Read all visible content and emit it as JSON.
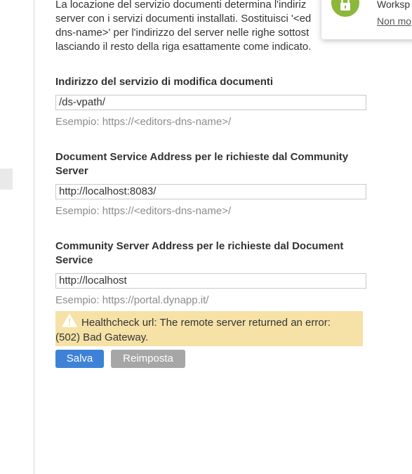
{
  "intro": {
    "text": "La locazione del servizio documenti determina l'indiriz\nserver con i servizi documenti installati. Sostituisci '<ed\ndns-name>' per l'indirizzo del server nelle righe sottost\nlasciando il resto della riga esattamente come indicato."
  },
  "fields": [
    {
      "label": "Indirizzo del servizio di modifica documenti",
      "value": "/ds-vpath/",
      "hint": "Esempio: https://<editors-dns-name>/"
    },
    {
      "label": "Document Service Address per le richieste dal Community Server",
      "value": "http://localhost:8083/",
      "hint": "Esempio: https://<editors-dns-name>/"
    },
    {
      "label": "Community Server Address per le richieste dal Document Service",
      "value": "http://localhost",
      "hint": "Esempio: https://portal.dynapp.it/"
    }
  ],
  "alert": {
    "icon": "warning-icon",
    "line1": "Healthcheck url: The remote server returned an error:",
    "line2": "(502) Bad Gateway."
  },
  "buttons": {
    "save": "Salva",
    "reset": "Reimposta"
  },
  "toast": {
    "icon": "lock-icon",
    "title": "Worksp",
    "link": "Non mo"
  },
  "colors": {
    "primary": "#3d82d6",
    "disabled": "#a6a6a6",
    "warning_bg": "#f6e2a6",
    "toast_icon": "#8cb83a"
  }
}
